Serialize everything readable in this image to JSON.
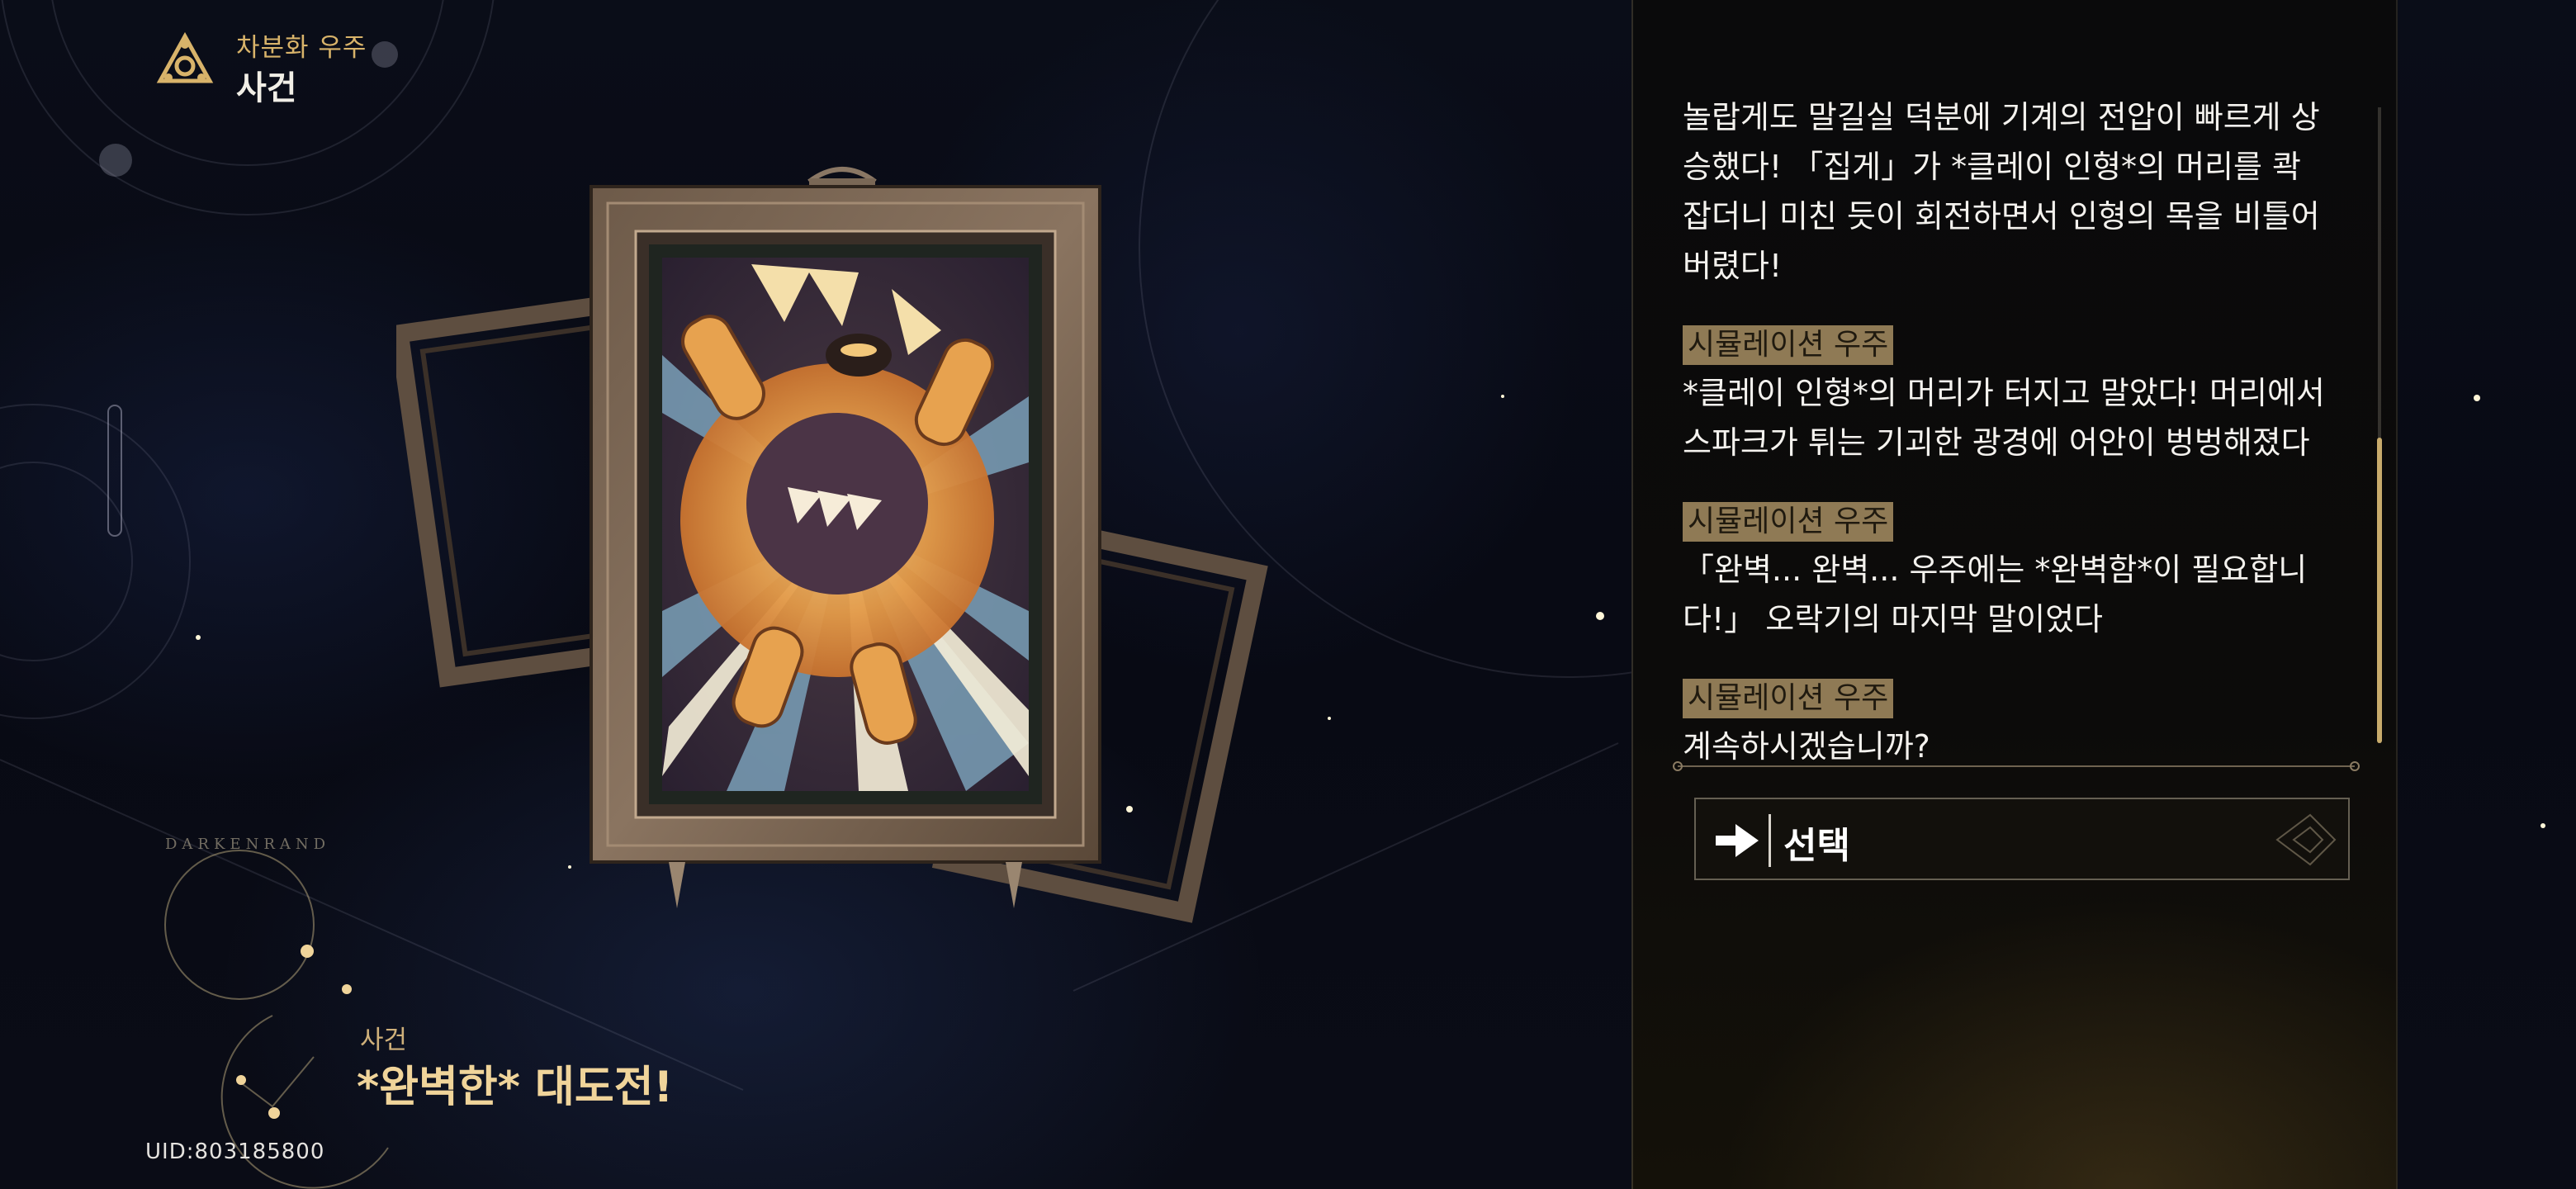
{
  "header": {
    "subtitle": "차분화 우주",
    "title": "사건",
    "icon": "triskelion-emblem-icon"
  },
  "event_info": {
    "constellation_label": "DARKENRAND",
    "category": "사건",
    "title": "*완벽한* 대도전!"
  },
  "uid": "UID:803185800",
  "dialogue": {
    "entries": [
      {
        "speaker": "",
        "text": "놀랍게도 말길실 덕분에 기계의 전압이 빠르게 상승했다! 「집게」가 *클레이 인형*의 머리를 콱 잡더니 미친 듯이 회전하면서 인형의 목을 비틀어버렸다!"
      },
      {
        "speaker": "시뮬레이션 우주",
        "text": "*클레이 인형*의 머리가 터지고 말았다! 머리에서 스파크가 튀는 기괴한 광경에 어안이 벙벙해졌다"
      },
      {
        "speaker": "시뮬레이션 우주",
        "text": "「완벽... 완벽... 우주에는 *완벽함*이 필요합니다!」 오락기의 마지막 말이었다"
      },
      {
        "speaker": "시뮬레이션 우주",
        "text": "계속하시겠습니까?"
      }
    ]
  },
  "choice": {
    "label": "선택",
    "icon": "arrow-right-icon"
  },
  "colors": {
    "accent_gold": "#d8b36a",
    "speaker_tag": "#8f7a55",
    "scroll_thumb": "#c8ab6c"
  }
}
